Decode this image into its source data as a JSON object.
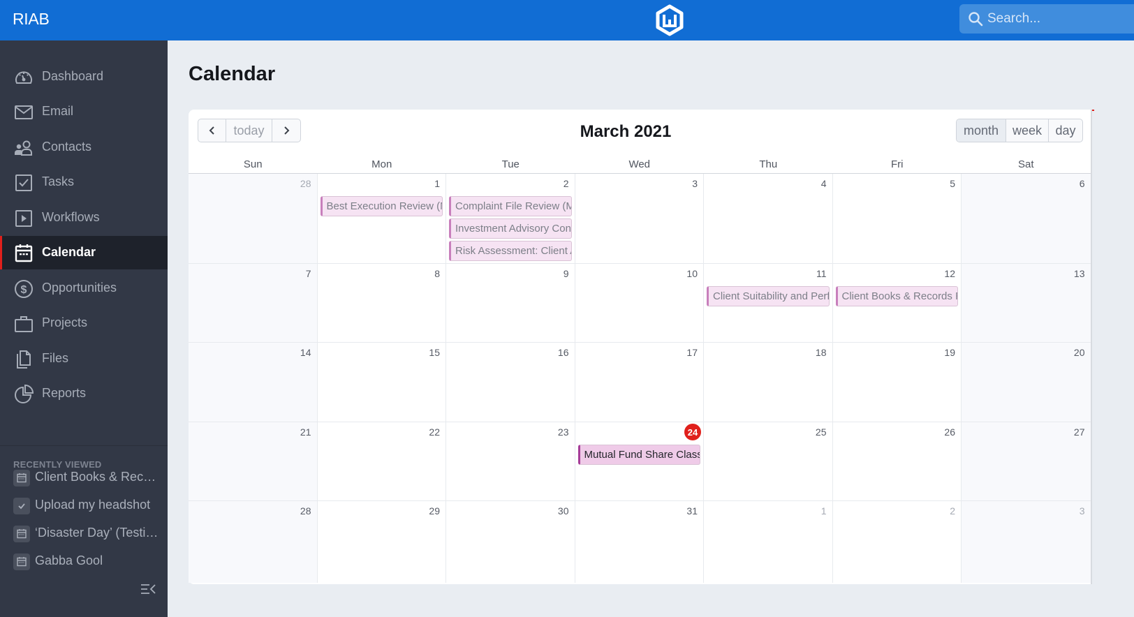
{
  "topbar": {
    "brand": "RIAB",
    "logo_icon": "hexagon-w-logo-icon",
    "search_placeholder": "Search..."
  },
  "sidebar": {
    "items": [
      {
        "label": "Dashboard",
        "icon": "dashboard-gauge-icon",
        "active": false
      },
      {
        "label": "Email",
        "icon": "envelope-icon",
        "active": false
      },
      {
        "label": "Contacts",
        "icon": "contacts-icon",
        "active": false
      },
      {
        "label": "Tasks",
        "icon": "checkbox-icon",
        "active": false
      },
      {
        "label": "Workflows",
        "icon": "play-square-icon",
        "active": false
      },
      {
        "label": "Calendar",
        "icon": "calendar-icon",
        "active": true
      },
      {
        "label": "Opportunities",
        "icon": "dollar-circle-icon",
        "active": false
      },
      {
        "label": "Projects",
        "icon": "briefcase-icon",
        "active": false
      },
      {
        "label": "Files",
        "icon": "files-icon",
        "active": false
      },
      {
        "label": "Reports",
        "icon": "pie-chart-icon",
        "active": false
      }
    ],
    "recently_viewed_title": "RECENTLY VIEWED",
    "recently_viewed": [
      {
        "label": "Client Books & Records Review",
        "icon": "calendar-icon"
      },
      {
        "label": "Upload my headshot",
        "icon": "check-icon"
      },
      {
        "label": "‘Disaster Day’ (Testing)",
        "icon": "calendar-icon"
      },
      {
        "label": "Gabba Gool",
        "icon": "calendar-icon"
      }
    ],
    "collapse_icon": "collapse-sidebar-icon"
  },
  "page": {
    "title": "Calendar"
  },
  "calendar": {
    "title": "March 2021",
    "nav": {
      "prev_icon": "chevron-left-icon",
      "today_label": "today",
      "next_icon": "chevron-right-icon"
    },
    "views": [
      {
        "label": "month",
        "active": true
      },
      {
        "label": "week",
        "active": false
      },
      {
        "label": "day",
        "active": false
      }
    ],
    "weekdays": [
      "Sun",
      "Mon",
      "Tue",
      "Wed",
      "Thu",
      "Fri",
      "Sat"
    ],
    "today": 24,
    "weeks": [
      [
        {
          "day": "28",
          "other": true,
          "events": []
        },
        {
          "day": "1",
          "other": false,
          "events": [
            {
              "title": "Best Execution Review (MI"
            }
          ]
        },
        {
          "day": "2",
          "other": false,
          "events": [
            {
              "title": "Complaint File Review (ML"
            },
            {
              "title": "Investment Advisory Cont"
            },
            {
              "title": "Risk Assessment: Client A"
            }
          ]
        },
        {
          "day": "3",
          "other": false,
          "events": []
        },
        {
          "day": "4",
          "other": false,
          "events": []
        },
        {
          "day": "5",
          "other": false,
          "events": []
        },
        {
          "day": "6",
          "other": false,
          "events": []
        }
      ],
      [
        {
          "day": "7",
          "other": false,
          "events": []
        },
        {
          "day": "8",
          "other": false,
          "events": []
        },
        {
          "day": "9",
          "other": false,
          "events": []
        },
        {
          "day": "10",
          "other": false,
          "events": []
        },
        {
          "day": "11",
          "other": false,
          "events": [
            {
              "title": "Client Suitability and Perfo"
            }
          ]
        },
        {
          "day": "12",
          "other": false,
          "events": [
            {
              "title": "Client Books & Records Re"
            }
          ]
        },
        {
          "day": "13",
          "other": false,
          "events": []
        }
      ],
      [
        {
          "day": "14",
          "other": false,
          "events": []
        },
        {
          "day": "15",
          "other": false,
          "events": []
        },
        {
          "day": "16",
          "other": false,
          "events": []
        },
        {
          "day": "17",
          "other": false,
          "events": []
        },
        {
          "day": "18",
          "other": false,
          "events": []
        },
        {
          "day": "19",
          "other": false,
          "events": []
        },
        {
          "day": "20",
          "other": false,
          "events": []
        }
      ],
      [
        {
          "day": "21",
          "other": false,
          "events": []
        },
        {
          "day": "22",
          "other": false,
          "events": []
        },
        {
          "day": "23",
          "other": false,
          "events": []
        },
        {
          "day": "24",
          "other": false,
          "today": true,
          "events": [
            {
              "title": "Mutual Fund Share Class R",
              "strong": true
            }
          ]
        },
        {
          "day": "25",
          "other": false,
          "events": []
        },
        {
          "day": "26",
          "other": false,
          "events": []
        },
        {
          "day": "27",
          "other": false,
          "events": []
        }
      ],
      [
        {
          "day": "28",
          "other": false,
          "events": []
        },
        {
          "day": "29",
          "other": false,
          "events": []
        },
        {
          "day": "30",
          "other": false,
          "events": []
        },
        {
          "day": "31",
          "other": false,
          "events": []
        },
        {
          "day": "1",
          "other": true,
          "events": []
        },
        {
          "day": "2",
          "other": true,
          "events": []
        },
        {
          "day": "3",
          "other": true,
          "events": []
        }
      ]
    ]
  },
  "colors": {
    "topbar": "#116dd4",
    "sidebar": "#323846",
    "sidebar_active": "#1e222b",
    "accent_red": "#e0201c",
    "event_bg": "#f6e3f3",
    "event_border": "#c87fbc"
  }
}
